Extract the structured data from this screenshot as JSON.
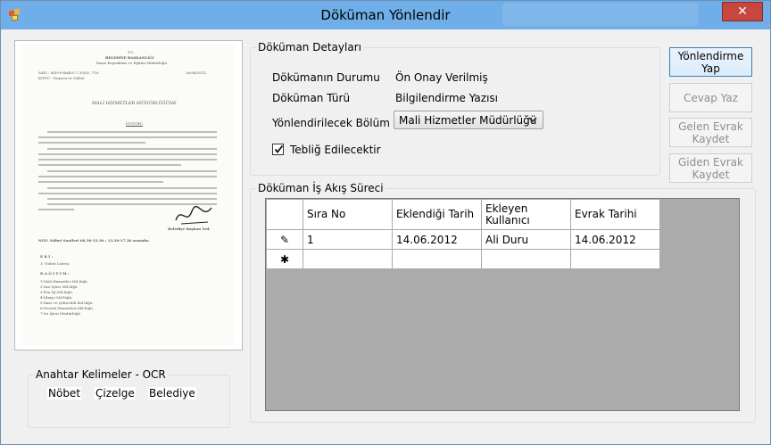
{
  "window": {
    "title": "Döküman Yönlendir",
    "close_label": "✕",
    "background_color": "#f0f0f0",
    "titlebar_color": "#6faee8",
    "close_color": "#c7463d"
  },
  "details": {
    "group_title": "Döküman Detayları",
    "status_label": "Dökümanın Durumu",
    "status_value": "Ön Onay Verilmiş",
    "type_label": "Döküman Türü",
    "type_value": "Bilgilendirme Yazısı",
    "department_label": "Yönlendirilecek Bölüm",
    "department_value": "Mali Hizmetler Müdürlüğü",
    "notify_label": "Tebliğ Edilecektir",
    "notify_checked": true
  },
  "buttons": {
    "route": "Yönlendirme Yap",
    "reply": "Cevap Yaz",
    "save_incoming": "Gelen Evrak Kaydet",
    "save_outgoing": "Giden Evrak Kaydet"
  },
  "workflow": {
    "group_title": "Döküman İş Akış Süreci",
    "columns": [
      "Sıra No",
      "Eklendiği Tarih",
      "Ekleyen Kullanıcı",
      "Evrak Tarihi"
    ],
    "rows": [
      [
        "1",
        "14.06.2012",
        "Ali Duru",
        "14.06.2012"
      ]
    ],
    "new_row_marker": "✱",
    "edit_row_marker": "✎"
  },
  "keywords": {
    "group_title": "Anahtar Kelimeler - OCR",
    "items": [
      "Nöbet",
      "Çizelge",
      "Belediye"
    ]
  },
  "document_preview": {
    "header_1": "T.C.",
    "header_2": "BELEDİYE BAŞKANLIĞI",
    "header_3": "İnsan Kaynakları ve Eğitim Müdürlüğü",
    "sayi": "SAYI : M39-8-BAB.0.7.30/0/\\ .716",
    "konu": "KONU : Duyuru ve Nöbet",
    "date": "26/06/2012",
    "recipient": "MALİ HİZMETLER MÜDÜRLÜĞÜNE",
    "heading": "DUYURU",
    "signoff": "Belediye Başkan Yrd.",
    "note": "NOT: Nöbet Saatleri 08.30-12.30 ; 13.30-17.30 arasıdır.",
    "ek": "E K İ :",
    "ek_item": "1- Nöbet Listesi.",
    "dagitim": "D A Ğ I T I M :",
    "dagitim_items": [
      "1-Mali Hizmetler Md.lüğü.",
      "2-Yazı İşleri Md.lüğü.",
      "3-Fen İşl.Md.lüğü.",
      "4-İtfaiye Md.lüğü.",
      "5-İmar ve Şehircilik Md.lüğü.",
      "6-Destek Hizmetleri Md.lüğü.",
      "7-Su İşleri Müdürlüğü"
    ]
  }
}
